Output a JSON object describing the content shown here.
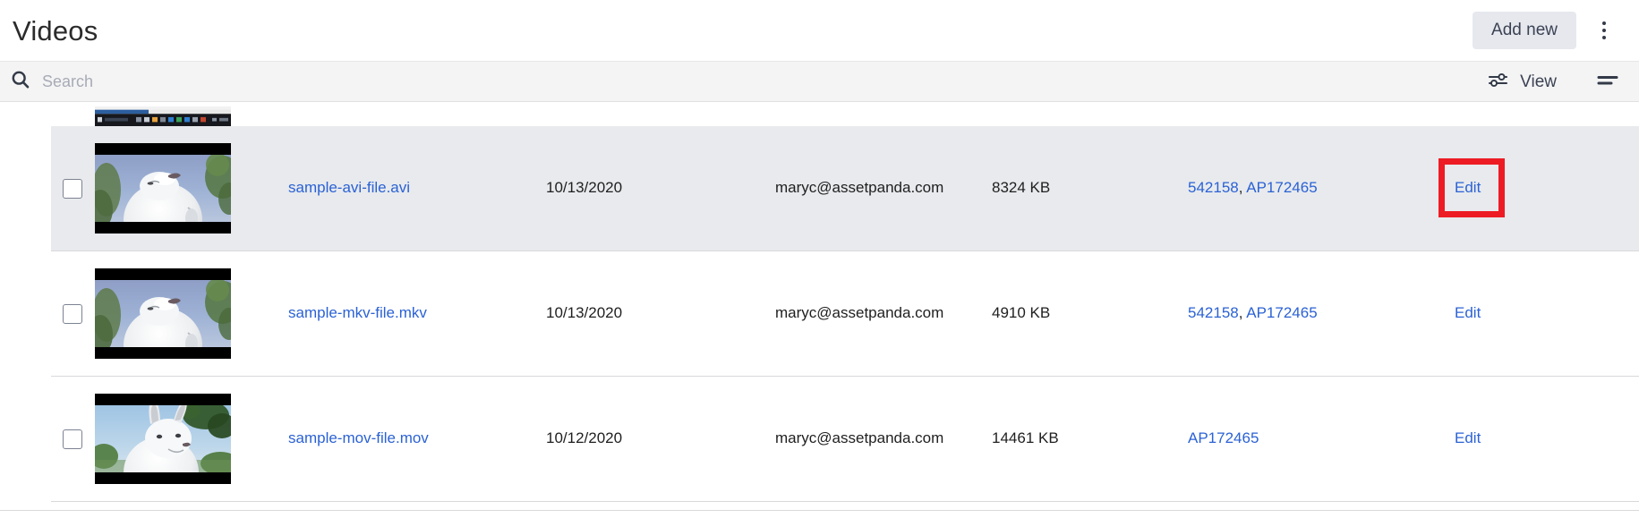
{
  "header": {
    "title": "Videos",
    "add_new_label": "Add new",
    "kebab_icon": "more-vertical-icon"
  },
  "toolbar": {
    "search_icon": "search-icon",
    "search_value": "",
    "search_placeholder": "Search",
    "view_label": "View",
    "view_icon": "sliders-icon",
    "sort_icon": "sort-descending-icon"
  },
  "colors": {
    "accent_link": "#2b62d4",
    "selected_row": "#e8eaed",
    "toolbar_bg": "#f4f4f5",
    "button_bg": "#e6e8ee",
    "annotation_red": "#ed1c24"
  },
  "table": {
    "rows": [
      {
        "id": "row-partial",
        "partial": true,
        "selected": false,
        "thumbnail": "desktop-screenshot-thumbnail",
        "name": "",
        "date": "",
        "user": "",
        "size": "",
        "assets": [],
        "edit_label": ""
      },
      {
        "id": "row-avi",
        "partial": false,
        "selected": true,
        "thumbnail": "big-buck-bunny-frame-closeup",
        "name": "sample-avi-file.avi",
        "date": "10/13/2020",
        "user": "maryc@assetpanda.com",
        "size": "8324 KB",
        "assets": [
          "542158",
          "AP172465"
        ],
        "assets_separator": ", ",
        "edit_label": "Edit",
        "annotated": true
      },
      {
        "id": "row-mkv",
        "partial": false,
        "selected": false,
        "thumbnail": "big-buck-bunny-frame-closeup",
        "name": "sample-mkv-file.mkv",
        "date": "10/13/2020",
        "user": "maryc@assetpanda.com",
        "size": "4910 KB",
        "assets": [
          "542158",
          "AP172465"
        ],
        "assets_separator": ", ",
        "edit_label": "Edit",
        "annotated": false
      },
      {
        "id": "row-mov",
        "partial": false,
        "selected": false,
        "thumbnail": "big-buck-bunny-frame-ears",
        "name": "sample-mov-file.mov",
        "date": "10/12/2020",
        "user": "maryc@assetpanda.com",
        "size": "14461 KB",
        "assets": [
          "AP172465"
        ],
        "assets_separator": "",
        "edit_label": "Edit",
        "annotated": false
      }
    ]
  }
}
